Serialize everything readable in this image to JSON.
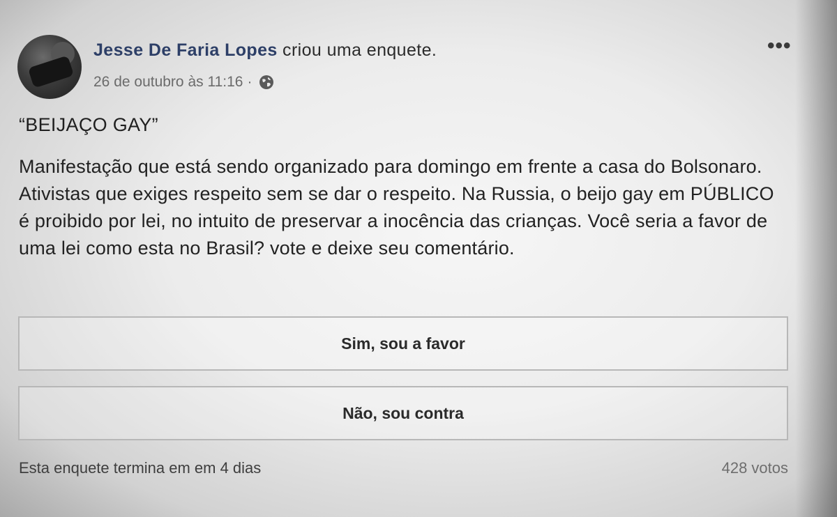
{
  "post": {
    "author": "Jesse De Faria Lopes",
    "action": " criou uma enquete.",
    "timestamp": "26 de outubro às 11:16",
    "separator": "·",
    "privacy_icon": "globe-icon",
    "more_icon": "more-options-icon",
    "more_glyph": "•••",
    "title": "“BEIJAÇO GAY”",
    "body": "Manifestação que está sendo organizado para domingo em frente a casa do Bolsonaro. Ativistas que exiges respeito sem se dar o respeito. Na Russia, o beijo gay em PÚBLICO é proibido por lei, no intuito de preservar a inocência das crianças. Você seria a favor de uma lei como esta no Brasil? vote e deixe seu comentário."
  },
  "poll": {
    "options": [
      {
        "label": "Sim, sou a favor"
      },
      {
        "label": "Não, sou contra"
      }
    ],
    "ends_text": "Esta enquete termina em em 4 dias",
    "votes_text": "428 votos"
  },
  "colors": {
    "author": "#2d3f67",
    "background": "#ececec",
    "option_border": "#b7b7b7"
  }
}
